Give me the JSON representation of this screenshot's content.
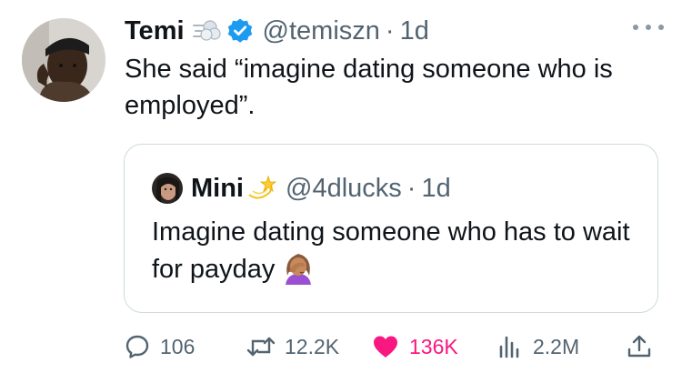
{
  "tweet": {
    "author": {
      "name": "Temi",
      "handle": "@temiszn",
      "time": "1d",
      "name_emoji": "dash-emoji",
      "verified_color": "#1d9bf0"
    },
    "separator": "·",
    "text": "She said “imagine dating someone who is employed”.",
    "more_icon": "more-dots-icon"
  },
  "quote": {
    "author": {
      "name": "Mini",
      "handle": "@4dlucks",
      "time": "1d",
      "name_emoji": "dizzy-emoji"
    },
    "separator": "·",
    "text": "Imagine dating someone who has to wait for payday",
    "trailing_emoji": "woman-facepalming-emoji"
  },
  "actions": {
    "reply": {
      "icon": "reply-icon",
      "count": "106"
    },
    "retweet": {
      "icon": "retweet-icon",
      "count": "12.2K"
    },
    "like": {
      "icon": "heart-icon",
      "count": "136K",
      "color": "#f91880",
      "liked": true
    },
    "views": {
      "icon": "views-icon",
      "count": "2.2M"
    },
    "share": {
      "icon": "share-icon"
    }
  },
  "colors": {
    "text": "#0f1419",
    "muted": "#536471",
    "border": "#cfd9de",
    "like": "#f91880",
    "verified": "#1d9bf0"
  }
}
